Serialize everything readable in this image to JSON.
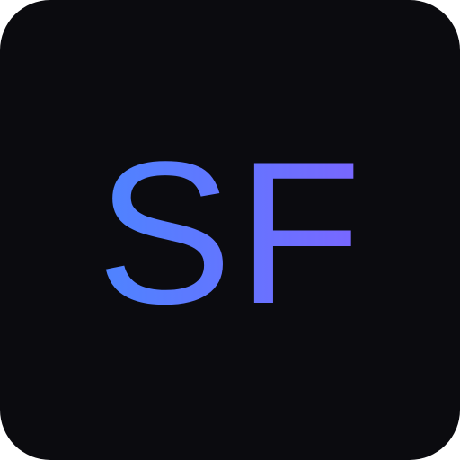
{
  "icon": {
    "monogram": "SF",
    "colors": {
      "background": "#0b0b0f",
      "gradient_start": "#4d84ff",
      "gradient_end": "#7a66ff"
    }
  }
}
